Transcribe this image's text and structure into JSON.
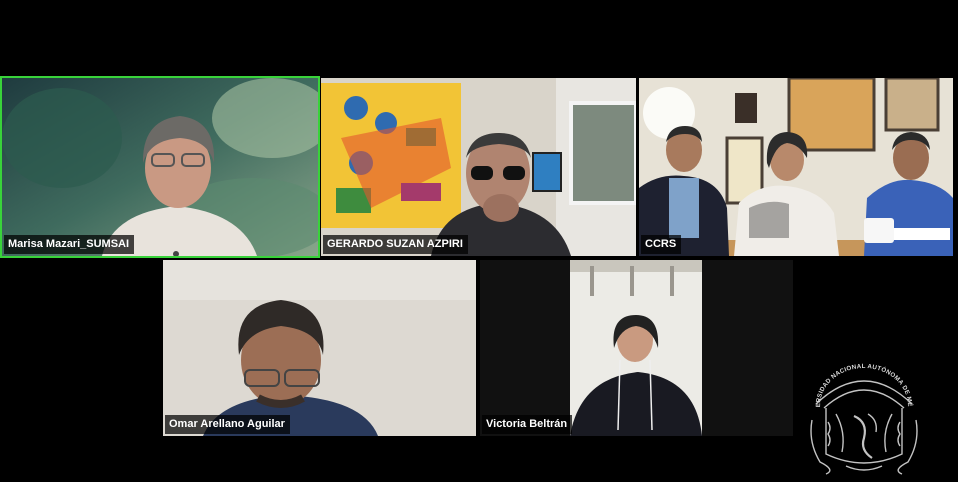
{
  "participants": [
    {
      "name": "Marisa Mazari_SUMSAI",
      "speaking": true
    },
    {
      "name": "GERARDO SUZAN AZPIRI",
      "speaking": false
    },
    {
      "name": "CCRS",
      "speaking": false
    },
    {
      "name": "Omar Arellano Aguilar",
      "speaking": false
    },
    {
      "name": "Victoria Beltrán",
      "speaking": false
    }
  ],
  "watermark": {
    "text": "UNIVERSIDAD NACIONAL AUTÓNOMA DE MÉXICO",
    "icon": "unam-seal-icon"
  },
  "colors": {
    "speaking_border": "#39d33a",
    "background": "#000000"
  }
}
